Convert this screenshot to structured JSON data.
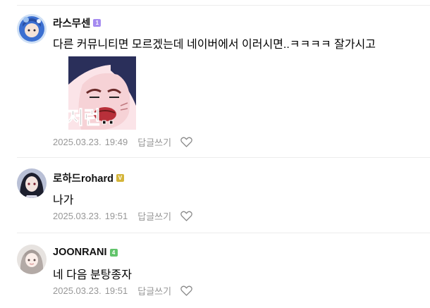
{
  "comments": [
    {
      "nickname": "라스무센",
      "badge_level": "1",
      "badge_color": "#a58bf0",
      "text": "다른 커뮤니티면 모르겠는데 네이버에서 이러시면..ㅋㅋㅋㅋ 잘가시고",
      "sticker_text": "저런..",
      "date": "2025.03.23.",
      "time": "19:49",
      "reply_label": "답글쓰기"
    },
    {
      "nickname": "로하드rohard",
      "badge_level": "V",
      "badge_color": "#d4b53a",
      "text": "나가",
      "date": "2025.03.23.",
      "time": "19:51",
      "reply_label": "답글쓰기"
    },
    {
      "nickname": "JOONRANI",
      "badge_level": "4",
      "badge_color": "#62c46b",
      "text": "네 다음 분탕종자",
      "date": "2025.03.23.",
      "time": "19:51",
      "reply_label": "답글쓰기"
    }
  ]
}
